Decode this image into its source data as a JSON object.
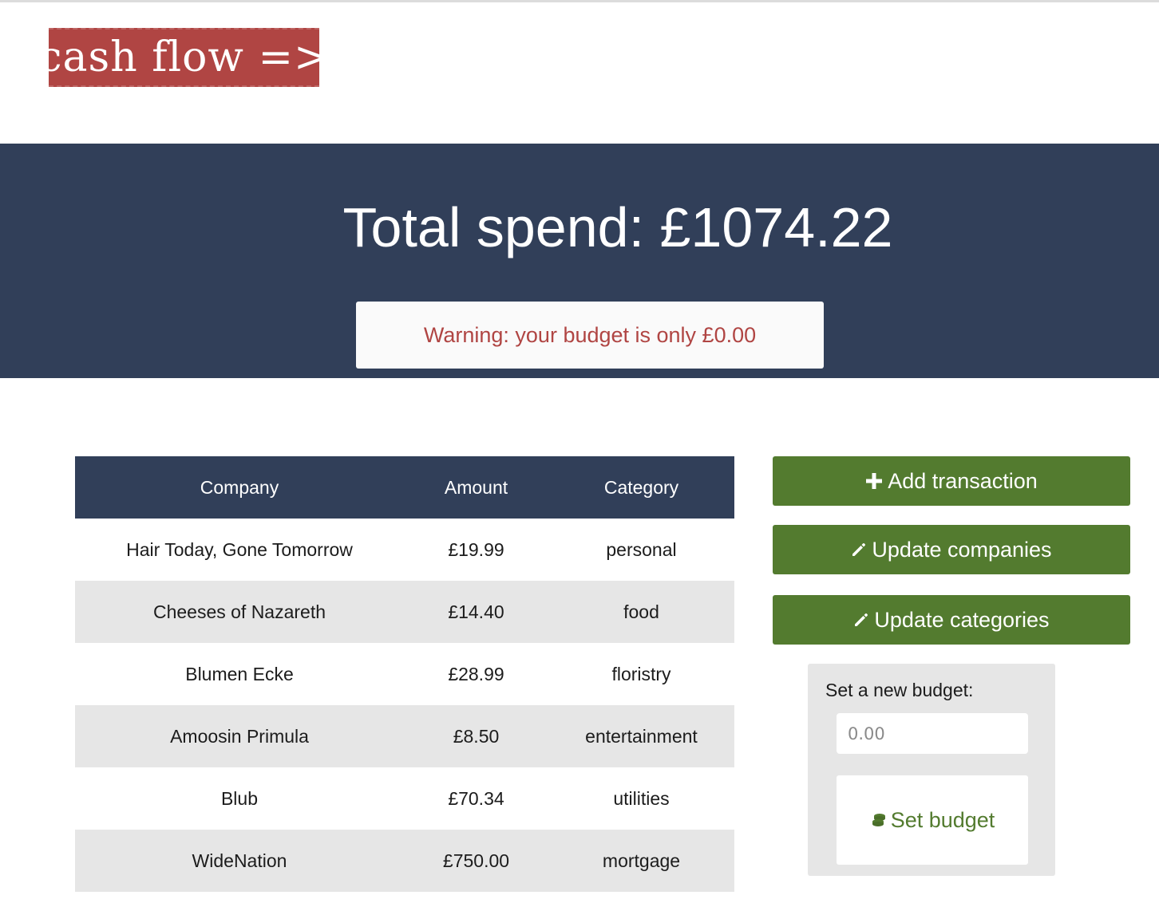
{
  "header": {
    "logo_text": "cash flow =>"
  },
  "hero": {
    "title": "Total spend: £1074.22",
    "warning": "Warning: your budget is only £0.00"
  },
  "table": {
    "columns": [
      "Company",
      "Amount",
      "Category"
    ],
    "rows": [
      {
        "company": "Hair Today, Gone Tomorrow",
        "amount": "£19.99",
        "category": "personal"
      },
      {
        "company": "Cheeses of Nazareth",
        "amount": "£14.40",
        "category": "food"
      },
      {
        "company": "Blumen Ecke",
        "amount": "£28.99",
        "category": "floristry"
      },
      {
        "company": "Amoosin Primula",
        "amount": "£8.50",
        "category": "entertainment"
      },
      {
        "company": "Blub",
        "amount": "£70.34",
        "category": "utilities"
      },
      {
        "company": "WideNation",
        "amount": "£750.00",
        "category": "mortgage"
      }
    ]
  },
  "actions": {
    "add_transaction": {
      "label": "Add transaction",
      "icon": "plus-icon"
    },
    "update_companies": {
      "label": "Update companies",
      "icon": "pencil-icon"
    },
    "update_categories": {
      "label": "Update categories",
      "icon": "pencil-icon"
    }
  },
  "budget": {
    "label": "Set a new budget:",
    "placeholder": "0.00",
    "button_label": "Set budget",
    "button_icon": "coins-icon"
  },
  "colors": {
    "navy": "#313f59",
    "logo_red": "#b04543",
    "green": "#537b2f",
    "warning_text": "#b04543",
    "row_alt": "#e6e6e6"
  }
}
